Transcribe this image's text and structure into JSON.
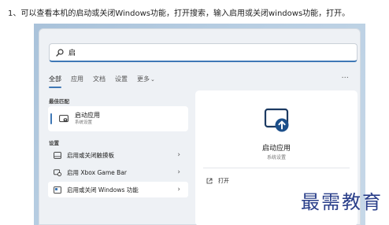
{
  "caption": "1、可以查看本机的启动或关闭Windows功能，打开搜索，输入启用或关闭windows功能，打开。",
  "search": {
    "value": "启",
    "icon": "search-icon"
  },
  "tabs": [
    {
      "label": "全部",
      "active": true
    },
    {
      "label": "应用"
    },
    {
      "label": "文档"
    },
    {
      "label": "设置"
    },
    {
      "label": "更多"
    }
  ],
  "more_chevron": "⌄",
  "overflow": "···",
  "best_match": {
    "section": "最佳匹配",
    "name": "启动应用",
    "sub": "系统设置",
    "icon": "startup-apps-icon"
  },
  "settings": {
    "section": "设置",
    "items": [
      {
        "label": "启用或关闭触摸板",
        "icon": "touchpad-icon"
      },
      {
        "label": "启用 Xbox Game Bar",
        "icon": "gamebar-icon"
      },
      {
        "label": "启用或关闭 Windows 功能",
        "icon": "windows-features-icon"
      }
    ],
    "chevron": "›"
  },
  "detail": {
    "name": "启动应用",
    "sub": "系统设置",
    "open_label": "打开",
    "icon": "startup-apps-icon"
  },
  "watermark": "最需教育",
  "colors": {
    "accent": "#3f78b6",
    "watermark": "#2a3f8a",
    "panel": "#eef1f5"
  }
}
